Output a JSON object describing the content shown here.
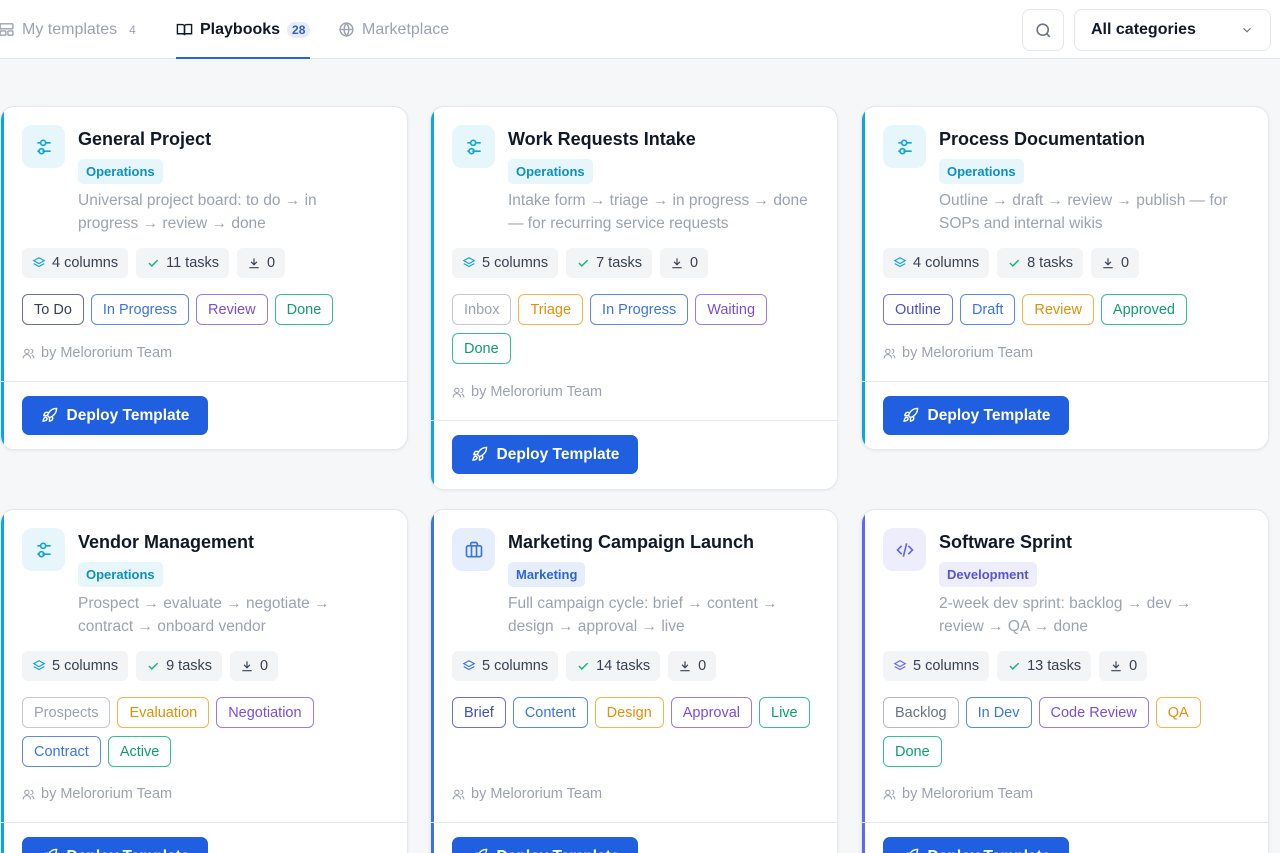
{
  "tabs": [
    {
      "label": "My templates",
      "count": "4",
      "icon": "layout-icon"
    },
    {
      "label": "Playbooks",
      "count": "28",
      "icon": "book-icon"
    },
    {
      "label": "Marketplace",
      "count": "",
      "icon": "globe-icon"
    }
  ],
  "filter": {
    "selected": "All categories"
  },
  "deploy_label": "Deploy Template",
  "author": "by Melororium Team",
  "cards": [
    {
      "title": "General Project",
      "category": "Operations",
      "description": "Universal project board: to do → in progress → review → done",
      "columns": "4 columns",
      "tasks": "11 tasks",
      "downloads": "0",
      "stages": [
        "To Do",
        "In Progress",
        "Review",
        "Done"
      ]
    },
    {
      "title": "Work Requests Intake",
      "category": "Operations",
      "description": "Intake form → triage → in progress → done — for recurring service requests",
      "columns": "5 columns",
      "tasks": "7 tasks",
      "downloads": "0",
      "stages": [
        "Inbox",
        "Triage",
        "In Progress",
        "Waiting",
        "Done"
      ]
    },
    {
      "title": "Process Documentation",
      "category": "Operations",
      "description": "Outline → draft → review → publish — for SOPs and internal wikis",
      "columns": "4 columns",
      "tasks": "8 tasks",
      "downloads": "0",
      "stages": [
        "Outline",
        "Draft",
        "Review",
        "Approved"
      ]
    },
    {
      "title": "Vendor Management",
      "category": "Operations",
      "description": "Prospect → evaluate → negotiate → contract → onboard vendor",
      "columns": "5 columns",
      "tasks": "9 tasks",
      "downloads": "0",
      "stages": [
        "Prospects",
        "Evaluation",
        "Negotiation",
        "Contract",
        "Active"
      ]
    },
    {
      "title": "Marketing Campaign Launch",
      "category": "Marketing",
      "description": "Full campaign cycle: brief → content → design → approval → live",
      "columns": "5 columns",
      "tasks": "14 tasks",
      "downloads": "0",
      "stages": [
        "Brief",
        "Content",
        "Design",
        "Approval",
        "Live"
      ]
    },
    {
      "title": "Software Sprint",
      "category": "Development",
      "description": "2-week dev sprint: backlog → dev → review → QA → done",
      "columns": "5 columns",
      "tasks": "13 tasks",
      "downloads": "0",
      "stages": [
        "Backlog",
        "In Dev",
        "Code Review",
        "QA",
        "Done"
      ]
    }
  ],
  "colors": {
    "accent_blue": "#1f5fe0",
    "ops": "#0ea5d9",
    "marketing": "#3b74e0",
    "development": "#6366f1",
    "stage_gray": "#6b7280",
    "stage_light_gray": "#9ca3af",
    "stage_blue": "#3b74e0",
    "stage_purple": "#8b5cf6",
    "stage_green": "#10b981",
    "stage_orange": "#f59e0b"
  }
}
